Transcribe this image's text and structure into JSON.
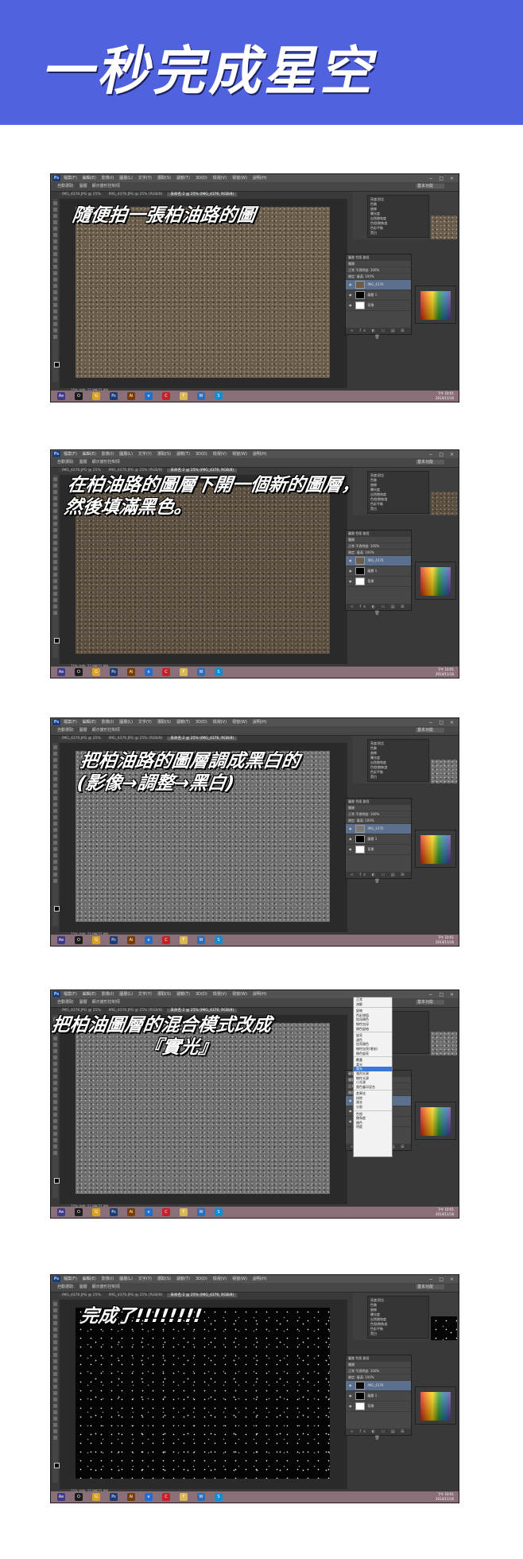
{
  "banner": {
    "title": "一秒完成星空"
  },
  "photoshop": {
    "logo": "Ps",
    "menus": [
      "檔案(F)",
      "編輯(E)",
      "影像(I)",
      "圖層(L)",
      "文字(Y)",
      "選取(S)",
      "濾鏡(T)",
      "3D(D)",
      "檢視(V)",
      "視窗(W)",
      "說明(H)"
    ],
    "options": [
      "自動選取:",
      "圖層",
      "顯示變形控制項"
    ],
    "workspace": "基本功能",
    "tabs": [
      "IMG_4376.JPG @ 25%",
      "IMG_4376.JPG @ 25% (RGB/8)",
      "未命名-2 @ 25% (IMG_4376, RGB/8)"
    ],
    "status": "25% 文件: 22.8M/22.8M",
    "adjust_panel": [
      "亮度/對比",
      "色階",
      "曲線",
      "曝光度",
      "自然飽和度",
      "色相/飽和度",
      "色彩平衡",
      "黑白"
    ],
    "layer_tabs": "圖層 色版 路徑",
    "layer_rows": [
      "種類",
      "正常 不透明度: 100%",
      "鎖定: 填滿: 100%"
    ],
    "layers": [
      "IMG_4376",
      "圖層 1",
      "背景"
    ],
    "clock_time": "下午 10:01",
    "clock_date": "2014/11/16"
  },
  "taskbar_icons": [
    "Ae",
    "O",
    "G",
    "Ps",
    "Ai",
    "e",
    "C",
    "F",
    "W",
    "S"
  ],
  "steps": [
    {
      "caption_lines": [
        "隨便拍一張柏油路的圖"
      ]
    },
    {
      "caption_lines": [
        "在柏油路的圖層下開一個新的圖層，",
        "然後填滿黑色。"
      ]
    },
    {
      "caption_lines": [
        "把柏油路的圖層調成黑白的",
        "(影像→調整→黑白)"
      ]
    },
    {
      "caption_lines": [
        "把柏油圖層的混合模式改成",
        "『實光』"
      ]
    },
    {
      "caption_lines": [
        "完成了!!!!!!!!"
      ]
    }
  ],
  "blend_menu": [
    "正常",
    "溶解",
    "變暗",
    "色彩增值",
    "加深顏色",
    "線性加深",
    "顏色變暗",
    "變亮",
    "濾色",
    "加亮顏色",
    "線性加亮(增加)",
    "顏色變亮",
    "覆蓋",
    "柔光",
    "實光",
    "強烈光源",
    "線性光源",
    "小光源",
    "實色疊印混合",
    "差異化",
    "排除",
    "減去",
    "分割",
    "色相",
    "飽和度",
    "顏色",
    "明度"
  ],
  "blend_selected": "實光"
}
